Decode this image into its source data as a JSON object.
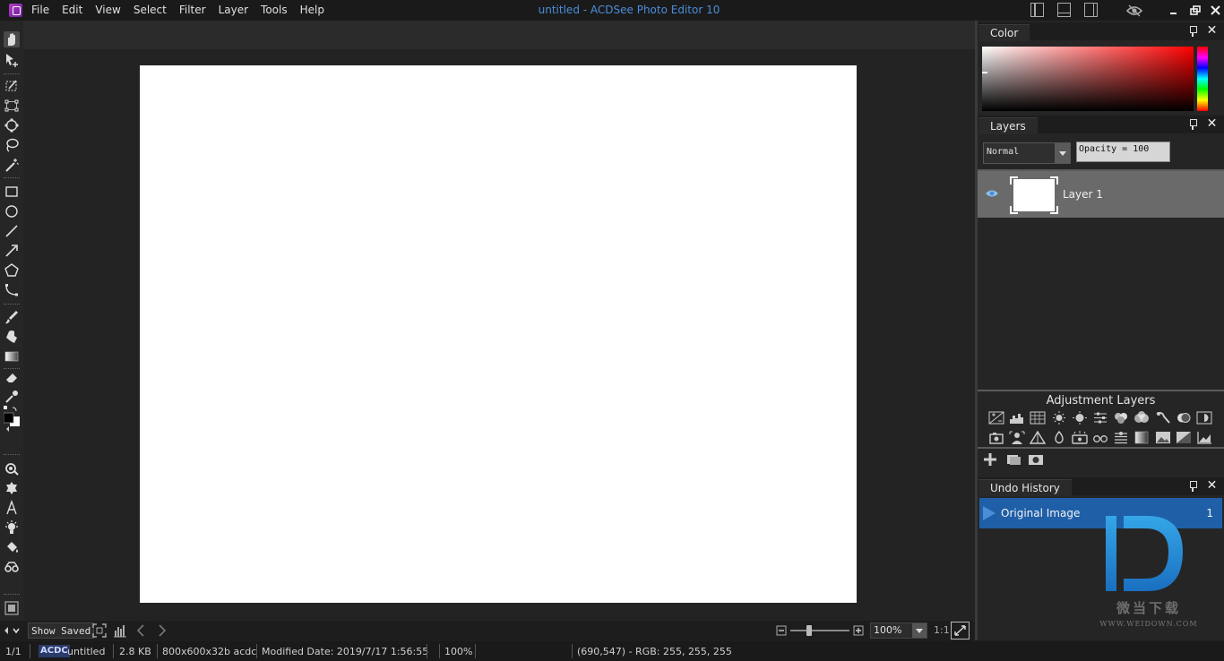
{
  "menubar": {
    "items": [
      "File",
      "Edit",
      "View",
      "Select",
      "Filter",
      "Layer",
      "Tools",
      "Help"
    ],
    "title": "untitled - ACDSee Photo Editor 10"
  },
  "color_panel": {
    "tab": "Color"
  },
  "layers_panel": {
    "tab": "Layers",
    "blend_mode": "Normal",
    "opacity_text": "Opacity = 100",
    "layers": [
      {
        "name": "Layer 1",
        "visible": true
      }
    ]
  },
  "adjustment_layers": {
    "title": "Adjustment Layers"
  },
  "undo_panel": {
    "tab": "Undo History",
    "items": [
      {
        "label": "Original Image",
        "index": "1"
      }
    ]
  },
  "navbar": {
    "show_saved": "Show Saved",
    "zoom": "100%",
    "ratio": "1:1"
  },
  "statusbar": {
    "page": "1/1",
    "format_badge": "ACDC",
    "filename": "untitled",
    "filesize": "2.8 KB",
    "dimensions": "800x600x32b acdc",
    "modified": "Modified Date: 2019/7/17 1:56:55",
    "zoom": "100%",
    "pixel_info": "(690,547) - RGB: 255, 255, 255"
  },
  "watermark": {
    "text": "微当下载",
    "url": "WWW.WEIDOWN.COM"
  },
  "colors": {
    "accent": "#1f5fa8",
    "title_blue": "#4a8ed8",
    "canvas": "#ffffff"
  }
}
